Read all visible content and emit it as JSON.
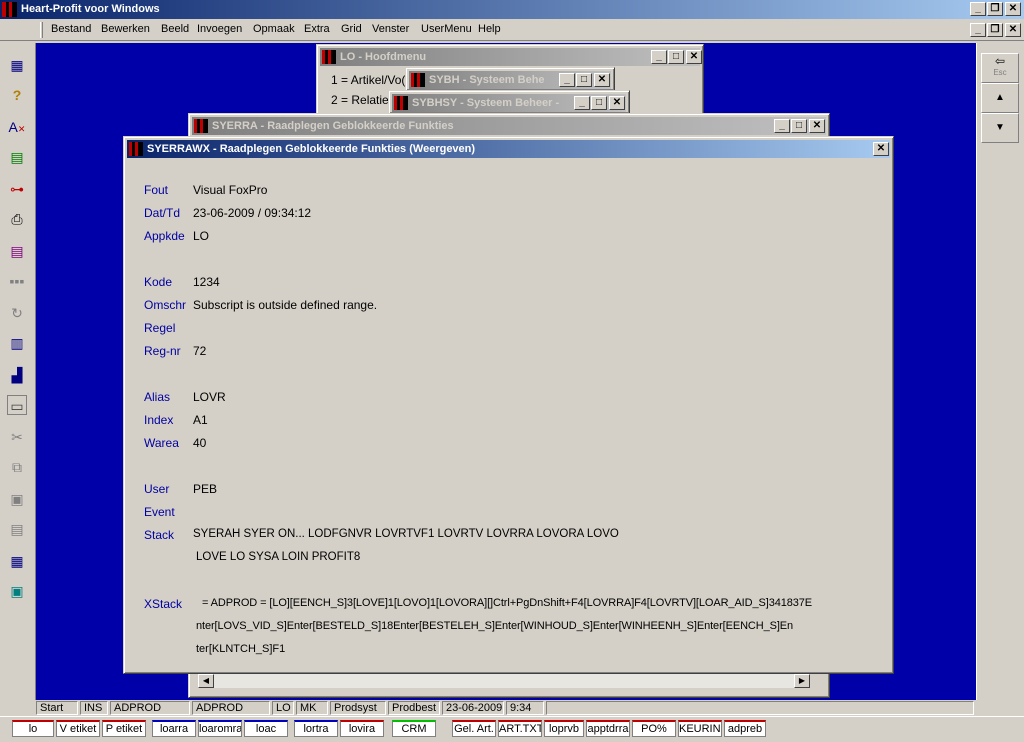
{
  "app": {
    "title": "Heart-Profit voor Windows"
  },
  "menu": [
    "Bestand",
    "Bewerken",
    "Beeld",
    "Invoegen",
    "Opmaak",
    "Extra",
    "Grid",
    "Venster",
    "UserMenu",
    "Help"
  ],
  "right_toolbar": {
    "esc_label": "Esc"
  },
  "windows": {
    "hoofdmenu": {
      "title": "LO - Hoofdmenu",
      "items": [
        "1 = Artikel/Vo(",
        "2 = Relatie"
      ]
    },
    "sybh": {
      "title": "SYBH - Systeem Behe"
    },
    "sybhsy": {
      "title": "SYBHSY - Systeem Beheer -"
    },
    "syerra": {
      "title": "SYERRA - Raadplegen Geblokkeerde Funkties"
    },
    "syerrawx": {
      "title": "SYERRAWX - Raadplegen Geblokkeerde Funkties (Weergeven)"
    }
  },
  "details": {
    "fout": {
      "label": "Fout",
      "value": "Visual FoxPro"
    },
    "dattd": {
      "label": "Dat/Td",
      "value": "23-06-2009 / 09:34:12"
    },
    "appkde": {
      "label": "Appkde",
      "value": "LO"
    },
    "kode": {
      "label": "Kode",
      "value": "1234"
    },
    "omschr": {
      "label": "Omschr",
      "value": "Subscript is outside defined range."
    },
    "regel": {
      "label": "Regel",
      "value": ""
    },
    "regnr": {
      "label": "Reg-nr",
      "value": "72"
    },
    "alias": {
      "label": "Alias",
      "value": "LOVR"
    },
    "index": {
      "label": "Index",
      "value": "A1"
    },
    "warea": {
      "label": "Warea",
      "value": "40"
    },
    "user": {
      "label": "User",
      "value": "PEB"
    },
    "event": {
      "label": "Event",
      "value": ""
    },
    "stack": {
      "label": "Stack",
      "line1": "SYERAH  SYER  ON...  LODFGNVR  LOVRTVF1  LOVRTV  LOVRRA  LOVORA  LOVO",
      "line2": "LOVE  LO  SYSA  LOIN  PROFIT8"
    },
    "xstack": {
      "label": "XStack",
      "line1": "= ADPROD = [LO][EENCH_S]3[LOVE]1[LOVO]1[LOVORA][]Ctrl+PgDnShift+F4[LOVRRA]F4[LOVRTV][LOAR_AID_S]341837E",
      "line2": "nter[LOVS_VID_S]Enter[BESTELD_S]18Enter[BESTELEH_S]Enter[WINHOUD_S]Enter[WINHEENH_S]Enter[EENCH_S]En",
      "line3": "ter[KLNTCH_S]F1"
    }
  },
  "statusbar": [
    "Start",
    "INS",
    "ADPROD",
    "ADPROD",
    "LO",
    "MK",
    "Prodsyst",
    "Prodbest",
    "23-06-2009",
    "9:34"
  ],
  "taskbar": [
    "lo",
    "V etiket",
    "P etiket",
    "loarra",
    "loaromra",
    "loac",
    "lortra",
    "lovira",
    "CRM",
    "Gel. Art.",
    "ART.TXT",
    "loprvb",
    "apptdrra",
    "PO%",
    "KEURING",
    "adpreb"
  ]
}
